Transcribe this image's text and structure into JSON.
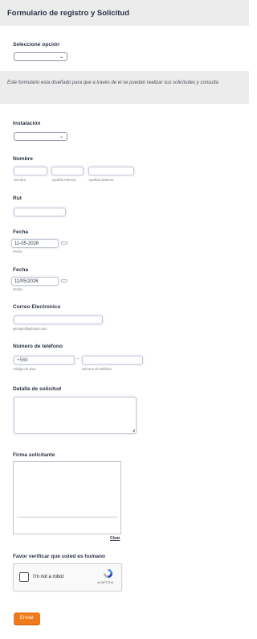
{
  "header": {
    "title": "Formulario de registro y Solicitud"
  },
  "option": {
    "label": "Seleccione opción",
    "value": ""
  },
  "description": {
    "text": "Este formulario esta diseñado para que a través de el se puedan realizar sus solicitudes y consulta"
  },
  "installation": {
    "label": "Instalación",
    "value": ""
  },
  "name": {
    "label": "Nombre",
    "sublabels": [
      "Nombre",
      "Apellido Paterno",
      "Apellido Materno"
    ],
    "values": [
      "",
      "",
      ""
    ]
  },
  "rut": {
    "label": "Rut",
    "value": ""
  },
  "date1": {
    "label": "Fecha",
    "value": "11-05-2026",
    "sublabel": "Fecha"
  },
  "date2": {
    "label": "Fecha",
    "value": "11/05/2026",
    "sublabel": "Fecha"
  },
  "email": {
    "label": "Correo Electronico",
    "value": "",
    "sublabel": "ejemplo@ejemplo.com"
  },
  "phone": {
    "label": "Número de teléfono",
    "area_value": "+569",
    "separator": "-",
    "number_value": "",
    "area_sublabel": "Código de área",
    "number_sublabel": "Número de teléfono"
  },
  "details": {
    "label": "Detalle de solicitud",
    "value": ""
  },
  "signature": {
    "label": "Firma solicitante",
    "clear_label": "Clear"
  },
  "captcha": {
    "label": "Favor verificar que usted es humano",
    "checkbox_label": "I'm not a robot",
    "brand": "reCAPTCHA"
  },
  "submit": {
    "label": "Enviar"
  },
  "colors": {
    "accent": "#ef7a1a",
    "band": "#ececec",
    "text": "#2c3345"
  },
  "icons": {
    "select": "chevron-down-icon",
    "date": "calendar-icon",
    "captcha": "recaptcha-logo-icon"
  }
}
